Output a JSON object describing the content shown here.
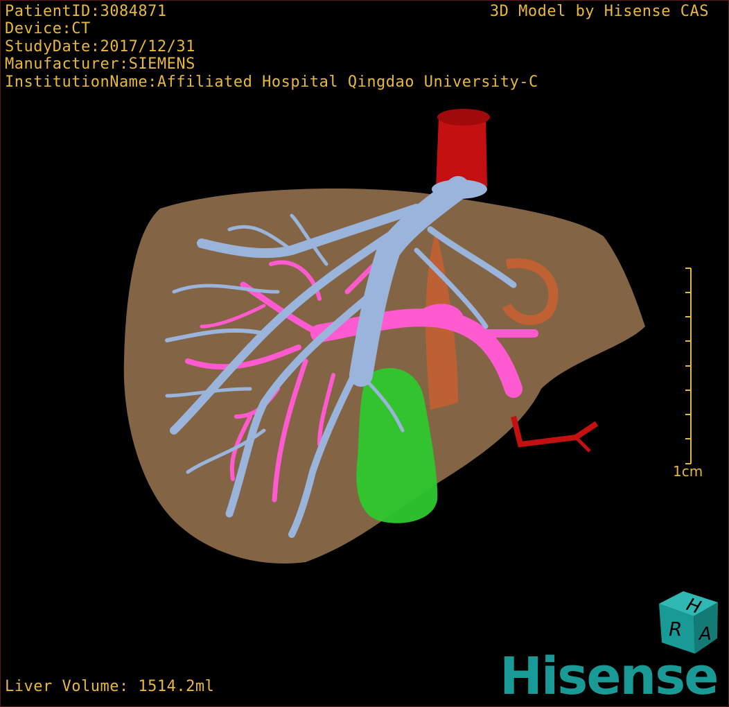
{
  "header": {
    "patient_id": "PatientID:3084871",
    "device": "Device:CT",
    "study_date": "StudyDate:2017/12/31",
    "manufacturer": "Manufacturer:SIEMENS",
    "institution": "InstitutionName:Affiliated Hospital Qingdao University-C"
  },
  "brand_top": "3D Model by Hisense CAS",
  "footer": {
    "liver_volume": "Liver Volume: 1514.2ml"
  },
  "scale_bar": {
    "label": "1cm"
  },
  "orientation_cube": {
    "letters": [
      "H",
      "R",
      "A"
    ]
  },
  "logo": {
    "text": "Hisense",
    "color": "#1a9a96"
  },
  "colors": {
    "text": "#e8b83a",
    "liver": "#8a6a4a",
    "hepatic_vein": "#9ab4dc",
    "portal_vein": "#ff5ad0",
    "artery": "#cc1010",
    "gallbladder": "#2ec82e",
    "cube": "#1a9a96"
  }
}
